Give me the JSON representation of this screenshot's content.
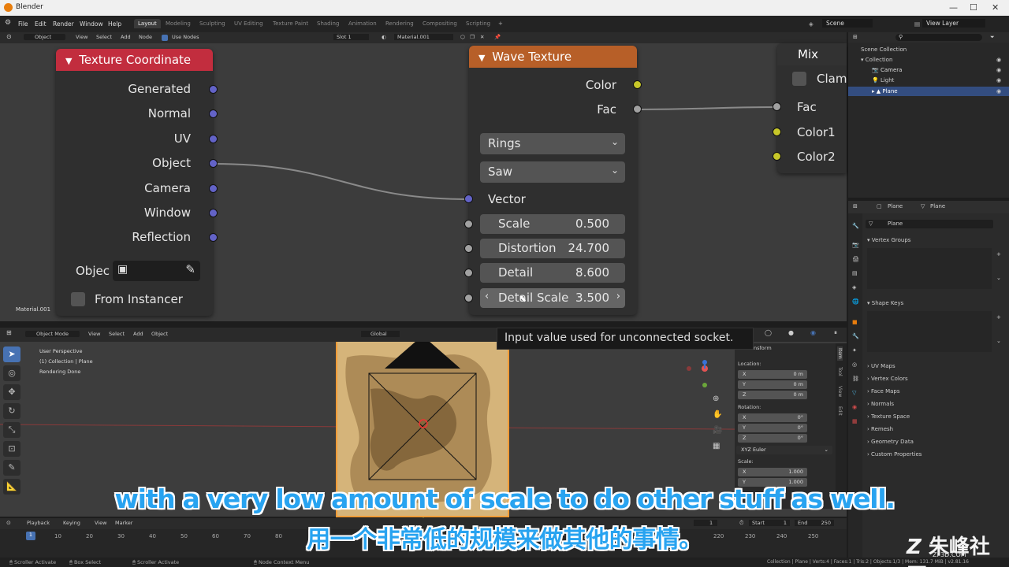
{
  "window": {
    "title": "Blender",
    "controls": [
      "—",
      "☐",
      "✕"
    ]
  },
  "menus": [
    "File",
    "Edit",
    "Render",
    "Window",
    "Help"
  ],
  "workspaces": [
    "Layout",
    "Modeling",
    "Sculpting",
    "UV Editing",
    "Texture Paint",
    "Shading",
    "Animation",
    "Rendering",
    "Compositing",
    "Scripting"
  ],
  "active_workspace": "Layout",
  "scene": "Scene",
  "view_layer": "View Layer",
  "node_header": {
    "mode": "Object",
    "items": [
      "View",
      "Select",
      "Add",
      "Node"
    ],
    "use_nodes": "Use Nodes",
    "slot": "Slot 1",
    "material": "Material.001"
  },
  "material_label": "Material.001",
  "texcoord_node": {
    "title": "Texture Coordinate",
    "outputs": [
      "Generated",
      "Normal",
      "UV",
      "Object",
      "Camera",
      "Window",
      "Reflection"
    ],
    "object_label": "Objec",
    "from_instancer": "From Instancer",
    "header_color": "#c22d3e"
  },
  "wave_node": {
    "title": "Wave Texture",
    "outputs": [
      "Color",
      "Fac"
    ],
    "type": "Rings",
    "profile": "Saw",
    "vector_label": "Vector",
    "fields": [
      {
        "label": "Scale",
        "value": "0.500"
      },
      {
        "label": "Distortion",
        "value": "24.700"
      },
      {
        "label": "Detail",
        "value": "8.600"
      },
      {
        "label": "Detail Scale",
        "value": "3.500"
      }
    ],
    "header_color": "#b75f28"
  },
  "mix_node": {
    "title": "Mix",
    "clamp": "Clam",
    "inputs": [
      "Fac",
      "Color1",
      "Color2"
    ]
  },
  "tooltip": "Input value used for unconnected socket.",
  "outliner": {
    "items": [
      "Scene Collection",
      "Collection",
      "Camera",
      "Light",
      "Plane"
    ],
    "selected": "Plane"
  },
  "properties": {
    "object": "Plane",
    "data": "Plane",
    "mesh": "Plane",
    "sections": [
      "Vertex Groups",
      "Shape Keys",
      "UV Maps",
      "Vertex Colors",
      "Face Maps",
      "Normals",
      "Texture Space",
      "Remesh",
      "Geometry Data",
      "Custom Properties"
    ]
  },
  "viewport": {
    "header": [
      "Object Mode",
      "View",
      "Select",
      "Add",
      "Object"
    ],
    "orientation": "Global",
    "overlay": [
      "User Perspective",
      "(1) Collection | Plane",
      "Rendering Done"
    ],
    "npanel_title": "Transform",
    "location_label": "Location:",
    "location": [
      {
        "axis": "X",
        "value": "0 m"
      },
      {
        "axis": "Y",
        "value": "0 m"
      },
      {
        "axis": "Z",
        "value": "0 m"
      }
    ],
    "rotation_label": "Rotation:",
    "rotation": [
      {
        "axis": "X",
        "value": "0°"
      },
      {
        "axis": "Y",
        "value": "0°"
      },
      {
        "axis": "Z",
        "value": "0°"
      }
    ],
    "rotation_mode": "XYZ Euler",
    "scale_label": "Scale:",
    "scale": [
      {
        "axis": "X",
        "value": "1.000"
      },
      {
        "axis": "Y",
        "value": "1.000"
      }
    ],
    "side_tabs": [
      "Item",
      "Tool",
      "View",
      "Edit"
    ]
  },
  "timeline": {
    "header": [
      "Playback",
      "Keying",
      "View",
      "Marker"
    ],
    "current_frame": "1",
    "start_label": "Start",
    "start": "1",
    "end_label": "End",
    "end": "250",
    "ticks": [
      "1",
      "10",
      "20",
      "30",
      "40",
      "50",
      "60",
      "70",
      "80",
      "220",
      "230",
      "240",
      "250"
    ]
  },
  "statusbar": {
    "left": [
      "Scroller Activate",
      "Box Select",
      "Scroller Activate",
      "Node Context Menu"
    ],
    "right": "Collection | Plane | Verts:4 | Faces:1 | Tris:2 | Objects:1/3 | Mem: 131.7 MiB | v2.81.16"
  },
  "subtitle_en": "with a very low amount of scale to do other stuff as well.",
  "subtitle_zh": "用一个非常低的规模来做其他的事情。",
  "watermark": "朱峰社区",
  "watermark_sub": "ZF3D.COM"
}
